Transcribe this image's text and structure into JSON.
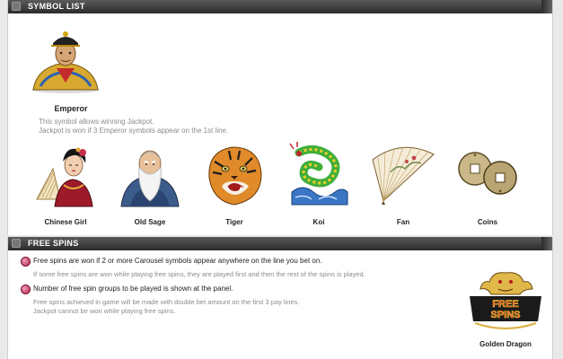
{
  "sections": {
    "symbol_list": {
      "title": "SYMBOL LIST"
    },
    "free_spins": {
      "title": "FREE SPINS"
    }
  },
  "emperor": {
    "name": "Emperor",
    "desc_line1": "This symbol allows winning Jackpot.",
    "desc_line2": "Jackpot is won if 3 Emperor symbols appear on the 1st line."
  },
  "symbols": [
    {
      "label": "Chinese Girl",
      "icon": "chinese-girl-icon"
    },
    {
      "label": "Old Sage",
      "icon": "old-sage-icon"
    },
    {
      "label": "Tiger",
      "icon": "tiger-icon"
    },
    {
      "label": "Koi",
      "icon": "koi-icon"
    },
    {
      "label": "Fan",
      "icon": "fan-icon"
    },
    {
      "label": "Coins",
      "icon": "coins-icon"
    }
  ],
  "free_spins": {
    "rule1": "Free spins are won if 2 or more Carousel symbols appear anywhere on the line you bet on.",
    "note1": "If some free spins are won while playing free spins, they are played first and then the rest of the spins is played.",
    "rule2": "Number of free spin groups to be played is shown at the panel.",
    "note2_line1": "Free spins achieved in game will be made with double bet amount on the first 3 pay lines.",
    "note2_line2": "Jackpot cannot be won while playing free spins.",
    "logo_text": "FREE SPINS",
    "golden_dragon": "Golden Dragon"
  },
  "colors": {
    "header_bg": "#3a3a3a",
    "bullet": "#b3204a",
    "muted_text": "#8b8b8b"
  }
}
